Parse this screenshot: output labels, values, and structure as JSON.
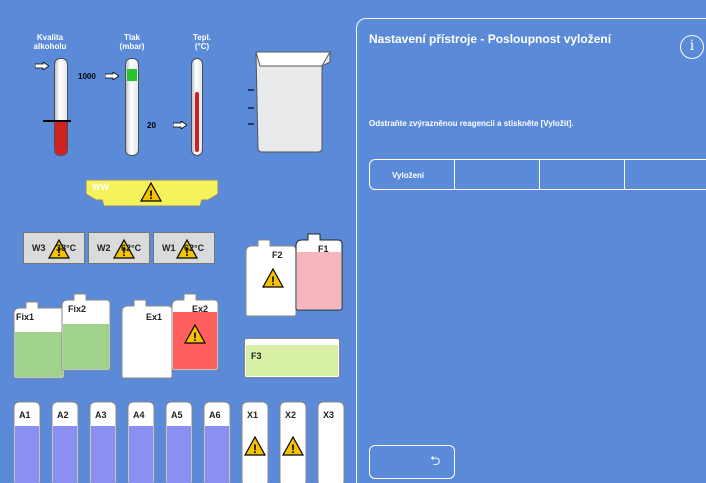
{
  "gauges": {
    "alcohol": {
      "label_line1": "Kvalita",
      "label_line2": "alkoholu"
    },
    "pressure": {
      "label_line1": "Tlak",
      "label_line2": "(mbar)",
      "tick_high": "1000",
      "tick_low": "20"
    },
    "temperature": {
      "label_line1": "Tepl.",
      "label_line2": "(°C)"
    }
  },
  "wax_bath": {
    "label": "WW"
  },
  "wax_chambers": [
    {
      "label": "W3",
      "temp": "38°C"
    },
    {
      "label": "W2",
      "temp": "62°C"
    },
    {
      "label": "W1",
      "temp": "62°C"
    }
  ],
  "fixatives": [
    {
      "label": "Fix1"
    },
    {
      "label": "Fix2"
    }
  ],
  "extras": [
    {
      "label": "Ex1"
    },
    {
      "label": "Ex2"
    }
  ],
  "formalin": [
    {
      "label": "F2"
    },
    {
      "label": "F1"
    },
    {
      "label": "F3"
    }
  ],
  "reagents": [
    {
      "label": "A1"
    },
    {
      "label": "A2"
    },
    {
      "label": "A3"
    },
    {
      "label": "A4"
    },
    {
      "label": "A5"
    },
    {
      "label": "A6"
    },
    {
      "label": "X1"
    },
    {
      "label": "X2"
    },
    {
      "label": "X3"
    }
  ],
  "panel": {
    "title": "Nastavení přístroje - Posloupnost vyložení",
    "message": "Odstraňte zvýrazněnou reagencii a stiskněte [Vyložit].",
    "segment_label": "Vyložení",
    "info_symbol": "i",
    "back_symbol": "⮌"
  },
  "colors": {
    "background": "#5b8bd8",
    "alcohol_fill": "#d02020",
    "pressure_fill": "#29c42e",
    "wax_yellow": "#f3f25a",
    "fixative_green": "#9fd28b",
    "ex2_red": "#ff5e5e",
    "f1_pink": "#f7b6bd",
    "f3_green": "#d7f0a5",
    "reagent_blue": "#8a8ff2"
  }
}
